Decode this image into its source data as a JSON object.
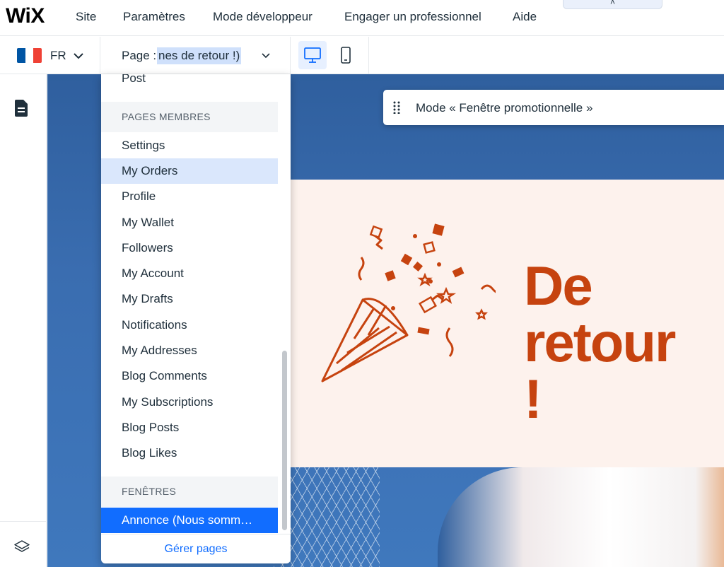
{
  "topbar": {
    "logo": "WiX",
    "menu": [
      "Site",
      "Paramètres",
      "Mode développeur",
      "Engager un professionnel",
      "Aide"
    ],
    "collapse_glyph": "˄"
  },
  "toolbar": {
    "language_code": "FR",
    "flag_colors": [
      "#0055a4",
      "#ffffff",
      "#ef4135"
    ],
    "page_prefix": "Page :",
    "page_name_visible": "nes de retour !)",
    "chevron": "⌵",
    "devices": [
      "desktop-icon",
      "mobile-icon"
    ]
  },
  "mode_bar": {
    "label": "Mode « Fenêtre promotionnelle »"
  },
  "popup": {
    "headline_lines": [
      "De",
      "retour",
      "!"
    ],
    "accent_color": "#c6430f",
    "background_color": "#fdf2ed"
  },
  "dropdown": {
    "partial_item": "Post",
    "section_members": "PAGES MEMBRES",
    "member_items": [
      "Settings",
      "My Orders",
      "Profile",
      "My Wallet",
      "Followers",
      "My Account",
      "My Drafts",
      "Notifications",
      "My Addresses",
      "Blog Comments",
      "My Subscriptions",
      "Blog Posts",
      "Blog Likes"
    ],
    "highlighted_item": "My Orders",
    "section_windows": "FENÊTRES",
    "window_items": [
      "Annonce (Nous somm…"
    ],
    "footer_link": "Gérer pages",
    "accent_color": "#116dff"
  }
}
